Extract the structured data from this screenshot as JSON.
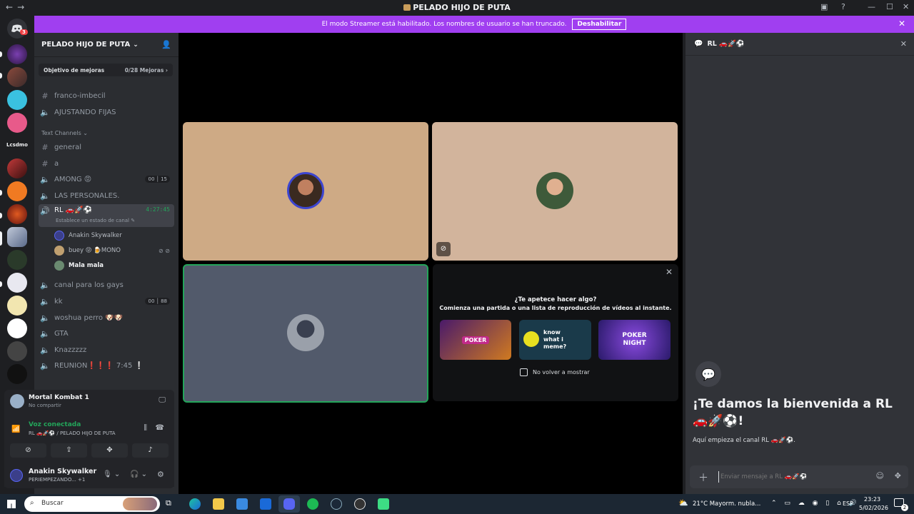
{
  "window": {
    "title": "PELADO HIJO DE PUTA",
    "nav_back": "←",
    "nav_fwd": "→"
  },
  "banner": {
    "text": "El modo Streamer está habilitado. Los nombres de usuario se han truncado.",
    "button": "Deshabilitar"
  },
  "rail": {
    "home_badge": "3",
    "label": "Lcsdmo"
  },
  "sidebar": {
    "guild_name": "PELADO HIJO DE PUTA",
    "boost": {
      "label": "Objetivo de mejoras",
      "progress": "0/28 Mejoras"
    },
    "top_channels": [
      {
        "name": "franco-imbecil",
        "type": "text"
      },
      {
        "name": "AJUSTANDO FIJAS",
        "type": "voice"
      }
    ],
    "category": "Text Channels",
    "channels": [
      {
        "name": "general",
        "type": "text"
      },
      {
        "name": "a",
        "type": "text"
      },
      {
        "name": "AMONG 😡",
        "type": "voice",
        "badge_a": "00",
        "badge_b": "15"
      },
      {
        "name": "LAS PERSONALES.",
        "type": "voice"
      },
      {
        "name": "RL 🚗🚀⚽",
        "type": "voice",
        "timer": "4:27:45",
        "status": "Establece un estado de canal ✎"
      }
    ],
    "members": [
      {
        "name": "Anakin Skywalker"
      },
      {
        "name": "buey 😝 🍺MONO"
      },
      {
        "name": "Mala mala"
      }
    ],
    "more_channels": [
      {
        "name": "canal para los gays",
        "type": "voice"
      },
      {
        "name": "kk",
        "type": "voice",
        "badge_a": "00",
        "badge_b": "88"
      },
      {
        "name": "woshua perro 🐶🐶",
        "type": "voice"
      },
      {
        "name": "GTA",
        "type": "voice"
      },
      {
        "name": "Knazzzzz",
        "type": "voice"
      },
      {
        "name": "REUNION❗❗❗ 7:45 ❕",
        "type": "voice"
      }
    ]
  },
  "activity": {
    "game": "Mortal Kombat 1",
    "game_sub": "No compartir"
  },
  "voice": {
    "status": "Voz conectada",
    "location": "RL 🚗🚀⚽ / PELADO HIJO DE PUTA"
  },
  "user": {
    "name": "Anakin Skywalker",
    "status": "PERIEMPEZANDO...",
    "extra": "+1"
  },
  "activities_panel": {
    "prompt": "¿Te apetece hacer algo?",
    "sub": "Comienza una partida o una lista de reproducción de vídeos al instante.",
    "games": [
      "POKER",
      "know what i meme?",
      "POKER NIGHT"
    ],
    "checkbox_label": "No volver a mostrar"
  },
  "chat": {
    "header": "RL 🚗🚀⚽",
    "welcome": "¡Te damos la bienvenida a RL 🚗🚀⚽!",
    "sub": "Aquí empieza el canal RL 🚗🚀⚽.",
    "placeholder": "Enviar mensaje a RL 🚗🚀⚽"
  },
  "taskbar": {
    "search": "Buscar",
    "weather": "21°C  Mayorm. nubla...",
    "lang": "ESP",
    "time": "23:23",
    "date": "5/02/2026",
    "notif": "2"
  },
  "colors": {
    "accent": "#5865f2",
    "streamer": "#a03ff0",
    "online": "#23a55a",
    "tile1": "#ceaa85",
    "tile2": "#d2b49c",
    "tile3": "#525a6b"
  }
}
